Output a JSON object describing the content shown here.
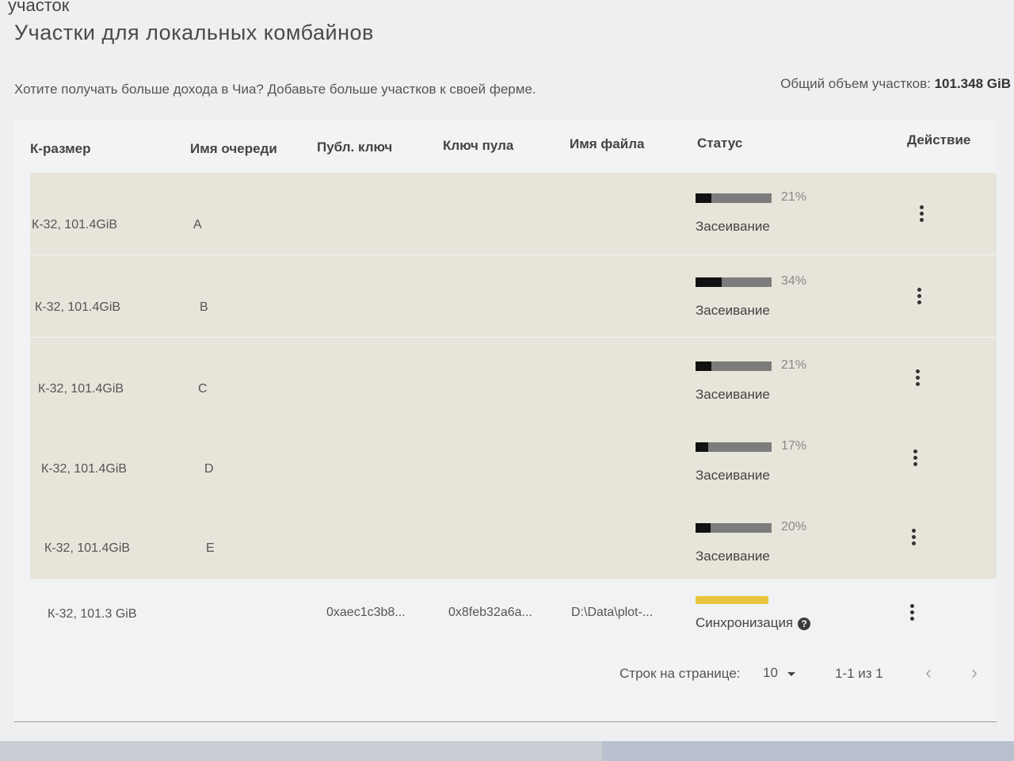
{
  "breadcrumb": "участок",
  "page": {
    "title": "Участки для локальных комбайнов",
    "subtitle": "Хотите получать больше дохода в Чиа? Добавьте больше участков к своей ферме.",
    "total_label": "Общий объем участков:",
    "total_value": "101.348 GiB"
  },
  "table": {
    "headers": {
      "k_size": "К-размер",
      "queue": "Имя очереди",
      "pub_key": "Публ. ключ",
      "pool_key": "Ключ пула",
      "filename": "Имя файла",
      "status": "Статус",
      "action": "Действие"
    },
    "rows": [
      {
        "k_size": "К-32, 101.4GiB",
        "queue": "A",
        "progress_pct": "21%",
        "progress": 0.21,
        "status": "Засеивание"
      },
      {
        "k_size": "К-32, 101.4GiB",
        "queue": "B",
        "progress_pct": "34%",
        "progress": 0.34,
        "status": "Засеивание"
      },
      {
        "k_size": "К-32, 101.4GiB",
        "queue": "C",
        "progress_pct": "21%",
        "progress": 0.21,
        "status": "Засеивание"
      },
      {
        "k_size": "К-32, 101.4GiB",
        "queue": "D",
        "progress_pct": "17%",
        "progress": 0.17,
        "status": "Засеивание"
      },
      {
        "k_size": "К-32, 101.4GiB",
        "queue": "E",
        "progress_pct": "20%",
        "progress": 0.2,
        "status": "Засеивание"
      }
    ],
    "final_row": {
      "k_size": "К-32, 101.3 GiB",
      "pub_key": "0xaec1c3b8...",
      "pool_key": "0x8feb32a6a...",
      "filename": "D:\\Data\\plot-...",
      "status": "Синхронизация",
      "help_symbol": "?"
    }
  },
  "pagination": {
    "rows_label": "Строк на странице:",
    "rows_value": "10",
    "range": "1-1 из 1",
    "prev": "‹",
    "next": "›"
  },
  "colors": {
    "progress_fill": "#111111",
    "progress_track": "#7c7c7c",
    "sync_bar": "#e8c640"
  }
}
